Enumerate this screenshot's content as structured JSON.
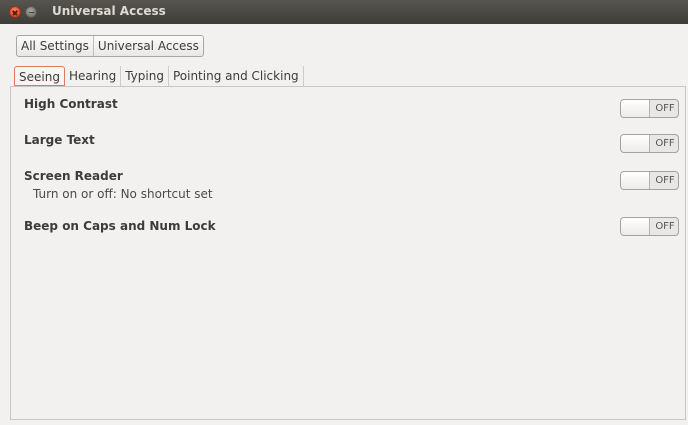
{
  "window": {
    "title": "Universal Access"
  },
  "breadcrumb": [
    "All Settings",
    "Universal Access"
  ],
  "tabs": [
    {
      "label": "Seeing",
      "active": true
    },
    {
      "label": "Hearing",
      "active": false
    },
    {
      "label": "Typing",
      "active": false
    },
    {
      "label": "Pointing and Clicking",
      "active": false
    }
  ],
  "seeing": {
    "high_contrast": {
      "label": "High Contrast",
      "state": "OFF"
    },
    "large_text": {
      "label": "Large Text",
      "state": "OFF"
    },
    "screen_reader": {
      "label": "Screen Reader",
      "shortcut": "Turn on or off:  No shortcut set",
      "state": "OFF"
    },
    "beep_caps": {
      "label": "Beep on Caps and Num Lock",
      "state": "OFF"
    }
  },
  "colors": {
    "titlebar": "#3d3c38",
    "close": "#e1492a",
    "active_tab_border": "#e07a5f",
    "background": "#f2f1f0"
  }
}
